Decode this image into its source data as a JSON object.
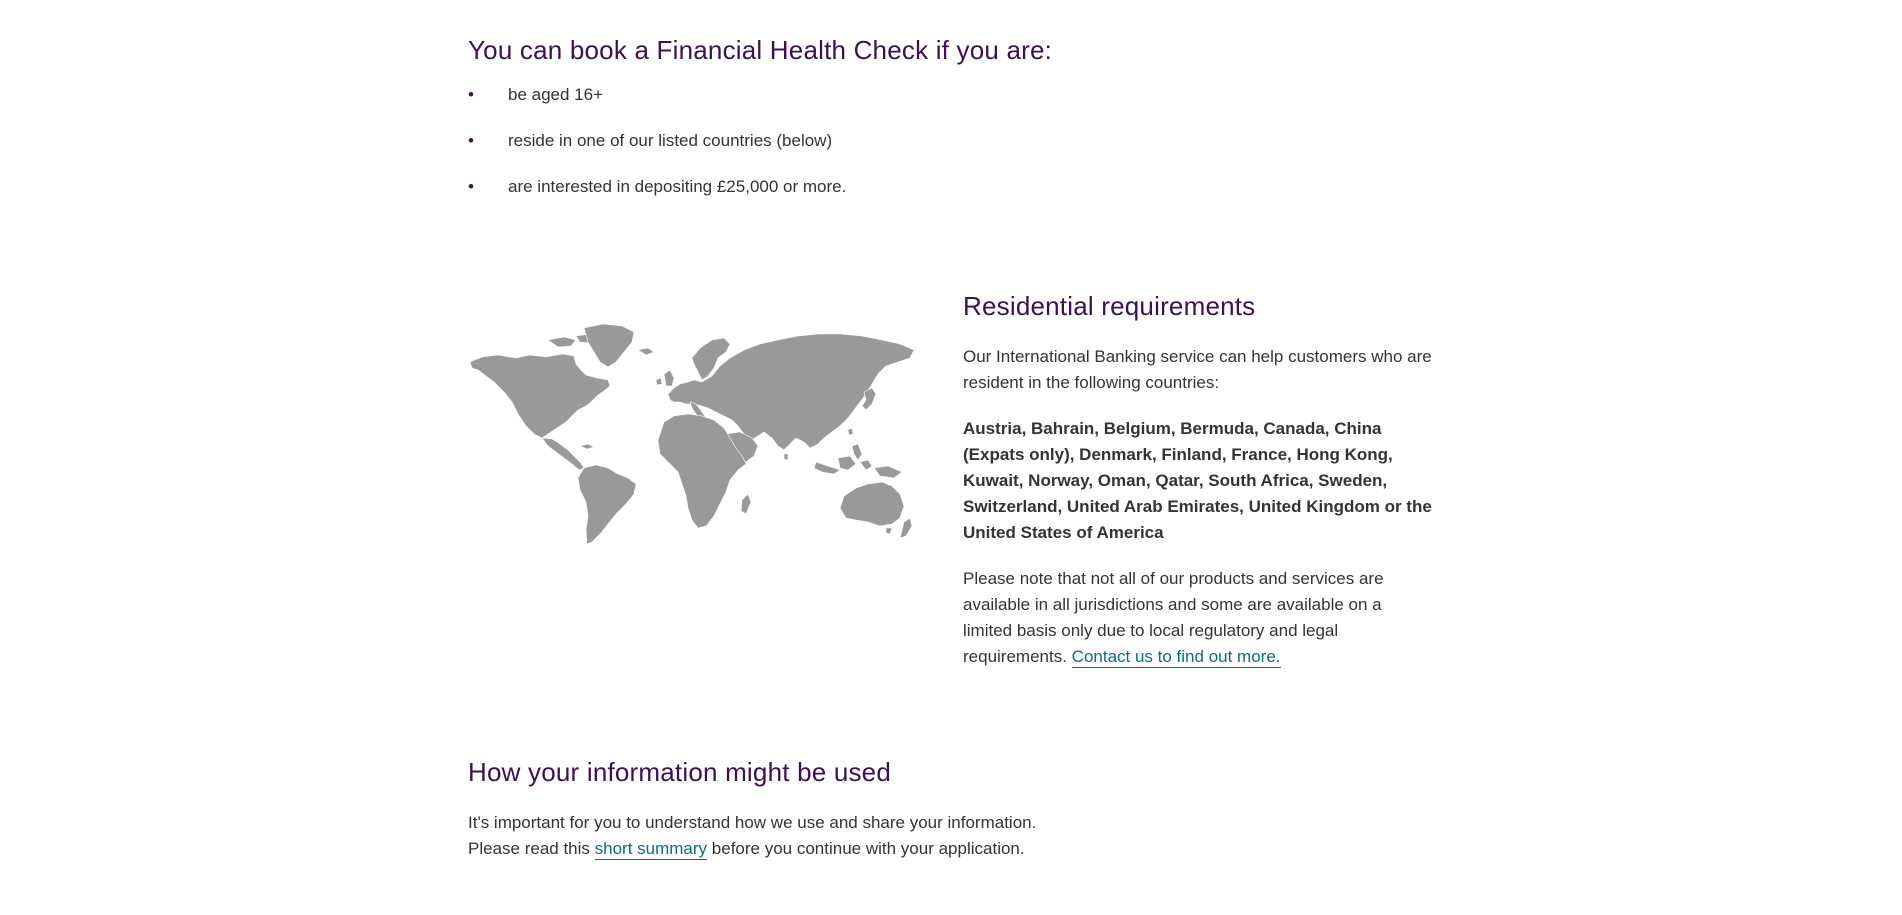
{
  "eligibility": {
    "title": "You can book a Financial Health Check if you are:",
    "items": [
      "be aged 16+",
      "reside in one of our listed countries (below)",
      "are interested in depositing £25,000 or more."
    ]
  },
  "residential": {
    "title": "Residential requirements",
    "intro": "Our International Banking service can help customers who are resident in the following countries:",
    "countries": "Austria, Bahrain, Belgium, Bermuda, Canada, China (Expats only), Denmark, Finland, France, Hong Kong, Kuwait, Norway, Oman, Qatar, South Africa, Sweden, Switzerland, United Arab Emirates, United Kingdom or the United States of America",
    "note": "Please note that not all of our products and services are available in all jurisdictions and some are available on a limited basis only due to local regulatory and legal requirements.",
    "contact_link": "Contact us to find out more."
  },
  "information": {
    "title": "How your information might be used",
    "line1": "It's important for you to understand how we use and share your information.",
    "line2_prefix": "Please read this",
    "link": "short summary",
    "line2_suffix": "before you continue with your application."
  },
  "colors": {
    "heading": "#3c1053",
    "link": "#0f6b78",
    "map": "#999999",
    "text": "#333333"
  },
  "icons": {
    "bullet": "•",
    "map": "world-map-icon"
  }
}
